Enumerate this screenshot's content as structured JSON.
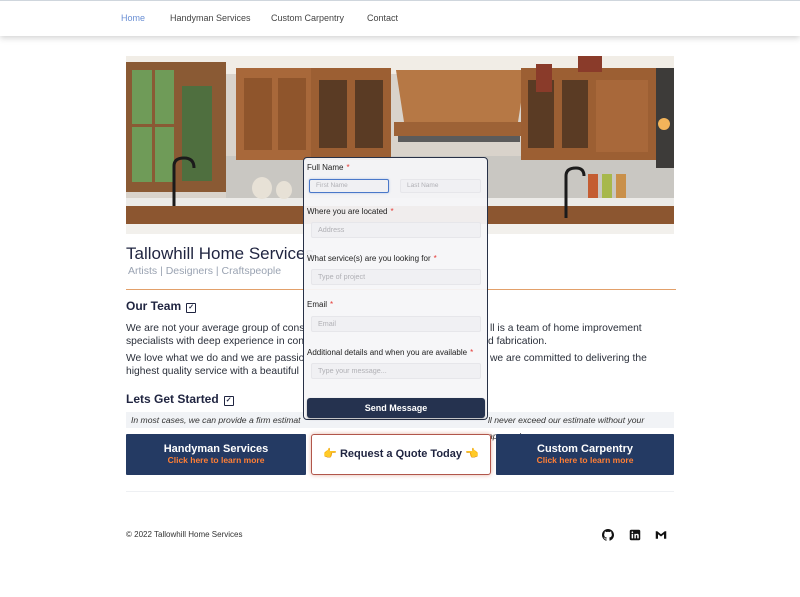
{
  "nav": {
    "items": [
      {
        "label": "Home"
      },
      {
        "label": "Handyman Services"
      },
      {
        "label": "Custom Carpentry"
      },
      {
        "label": "Contact"
      }
    ]
  },
  "brand": {
    "title": "Tallowhill Home Services",
    "tagline": "Artists | Designers | Craftspeople",
    "accent_color": "#e2a06a",
    "navy": "#243a63",
    "cta_orange": "#ff7f35"
  },
  "team": {
    "heading": "Our Team",
    "p1_line1": "We are not your average group of cons",
    "p1_right1": "ll is a team of home improvement",
    "p1_line2": "specialists with deep experience in con",
    "p1_right2": "d fabrication.",
    "p2_line1": "We love what we do and we are passio",
    "p2_right1": "we are committed to delivering the",
    "p2_line2": "highest quality service with a beautiful"
  },
  "started": {
    "heading": "Lets Get Started",
    "note_left": "In most cases, we can provide a firm estimat",
    "note_right": "ll never exceed our estimate without your approval."
  },
  "cards": {
    "handyman": {
      "title": "Handyman Services",
      "cta": "Click here to learn more"
    },
    "quote": {
      "label": "👉 Request a Quote Today 👈"
    },
    "carpentry": {
      "title": "Custom Carpentry",
      "cta": "Click here to learn more"
    }
  },
  "form": {
    "full_name_label": "Full Name",
    "first_name_placeholder": "First Name",
    "last_name_placeholder": "Last Name",
    "location_label": "Where you are located",
    "address_placeholder": "Address",
    "services_label": "What service(s) are you looking for",
    "project_placeholder": "Type of project",
    "email_label": "Email",
    "email_placeholder": "Email",
    "details_label": "Additional details and when you are available",
    "message_placeholder": "Type your message...",
    "required_mark": "*",
    "submit_label": "Send Message"
  },
  "footer": {
    "copyright": "© 2022 Tallowhill Home Services",
    "social": [
      {
        "icon": "github-icon"
      },
      {
        "icon": "linkedin-icon"
      },
      {
        "icon": "gmail-icon"
      }
    ]
  }
}
